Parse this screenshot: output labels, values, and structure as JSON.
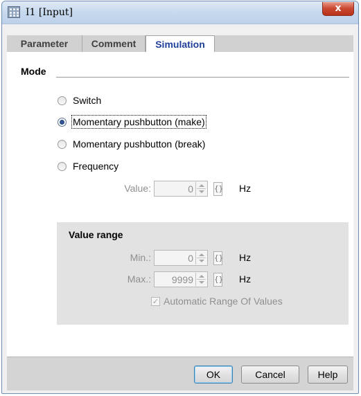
{
  "window": {
    "title": "I1 [Input]",
    "close_glyph": "x"
  },
  "tabs": [
    {
      "label": "Parameter",
      "active": false
    },
    {
      "label": "Comment",
      "active": false
    },
    {
      "label": "Simulation",
      "active": true
    }
  ],
  "mode": {
    "heading": "Mode",
    "options": [
      {
        "label": "Switch",
        "selected": false
      },
      {
        "label": "Momentary pushbutton (make)",
        "selected": true
      },
      {
        "label": "Momentary pushbutton (break)",
        "selected": false
      },
      {
        "label": "Frequency",
        "selected": false
      }
    ],
    "value_label": "Value:",
    "value": "0",
    "brace": "{}",
    "unit": "Hz"
  },
  "value_range": {
    "heading": "Value range",
    "min_label": "Min.:",
    "min_value": "0",
    "max_label": "Max.:",
    "max_value": "9999",
    "brace": "{}",
    "unit": "Hz",
    "auto_label": "Automatic Range Of Values",
    "auto_checked": true,
    "check_glyph": "✓"
  },
  "buttons": {
    "ok": "OK",
    "cancel": "Cancel",
    "help": "Help"
  },
  "colors": {
    "active_tab_text": "#1f3f9a",
    "disabled_text": "#8f8f8f",
    "close_button": "#c9462f"
  }
}
